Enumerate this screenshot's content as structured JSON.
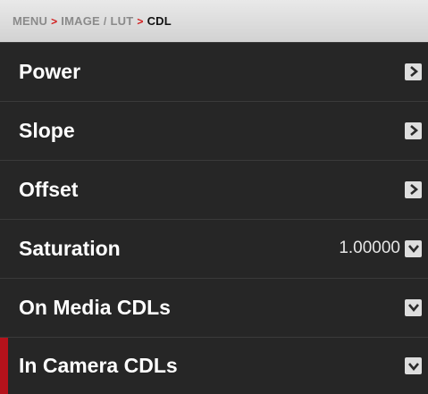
{
  "breadcrumb": {
    "menu": "MENU",
    "sep1": ">",
    "image": "IMAGE",
    "sep2": "/",
    "lut": "LUT",
    "sep3": ">",
    "current": "CDL"
  },
  "menu": {
    "items": [
      {
        "label": "Power",
        "icon": "chevron-right-icon"
      },
      {
        "label": "Slope",
        "icon": "chevron-right-icon"
      },
      {
        "label": "Offset",
        "icon": "chevron-right-icon"
      },
      {
        "label": "Saturation",
        "value": "1.00000",
        "icon": "chevron-down-icon"
      },
      {
        "label": "On Media CDLs",
        "icon": "chevron-down-icon"
      },
      {
        "label": "In Camera CDLs",
        "icon": "chevron-down-icon",
        "selected": true
      }
    ]
  },
  "colors": {
    "accent_red": "#b5121b",
    "menu_bg": "#262626",
    "header_bg": "#dcdcdc"
  }
}
